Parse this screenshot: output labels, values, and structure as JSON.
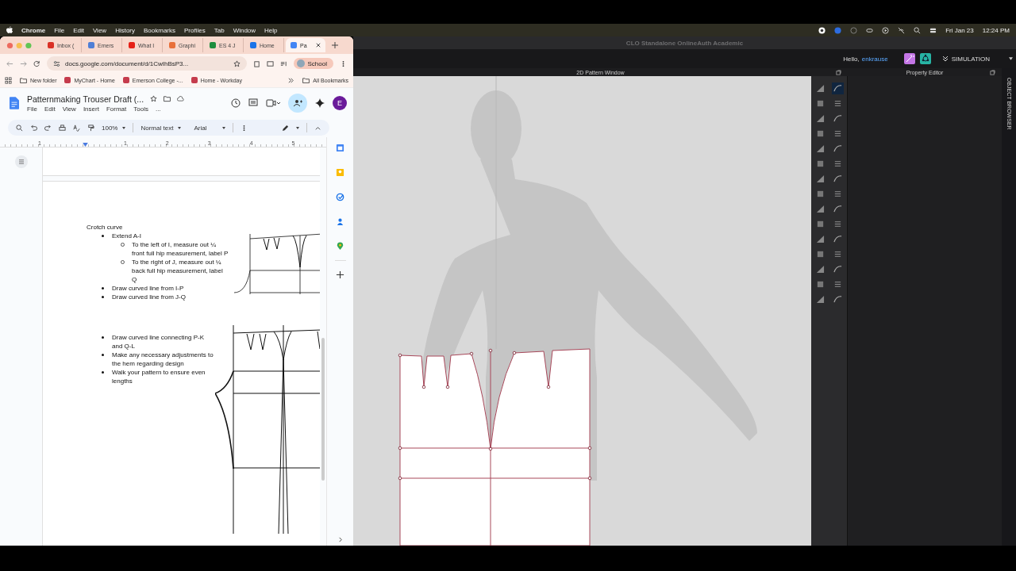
{
  "menu_bar": {
    "app": "Chrome",
    "items": [
      "File",
      "Edit",
      "View",
      "History",
      "Bookmarks",
      "Profiles",
      "Tab",
      "Window",
      "Help"
    ],
    "date": "Fri Jan 23",
    "time": "12:24 PM"
  },
  "browser": {
    "tabs": [
      {
        "label": "Inbox (",
        "color": "#d93025",
        "selected": false
      },
      {
        "label": "Emers",
        "color": "#4f7fd6",
        "selected": false
      },
      {
        "label": "What I",
        "color": "#e62117",
        "selected": false
      },
      {
        "label": "Graphi",
        "color": "#e8703a",
        "selected": false
      },
      {
        "label": "ES 4 J",
        "color": "#1e8e3e",
        "selected": false
      },
      {
        "label": "Home",
        "color": "#1a73e8",
        "selected": false
      },
      {
        "label": "Pa",
        "color": "#4285f4",
        "selected": true
      }
    ],
    "address": "docs.google.com/document/d/1CwIhBsP3...",
    "profile": "School",
    "bookmarks": [
      {
        "label": "New folder",
        "kind": "folder"
      },
      {
        "label": "MyChart - Home",
        "kind": "site"
      },
      {
        "label": "Emerson College -...",
        "kind": "site"
      },
      {
        "label": "Home - Workday",
        "kind": "site"
      }
    ],
    "all_bookmarks": "All Bookmarks"
  },
  "doc": {
    "title": "Patternmaking Trouser Draft (...",
    "menus": [
      "File",
      "Edit",
      "View",
      "Insert",
      "Format",
      "Tools",
      "..."
    ],
    "avatar": "E",
    "zoom": "100%",
    "style": "Normal text",
    "font": "Arial",
    "ruler": [
      "1",
      "1",
      "2",
      "3",
      "4",
      "5"
    ],
    "heading": "Crotch curve",
    "steps": [
      {
        "text": "Extend A-I",
        "children": [
          {
            "text": "To the left of I, measure out ¼ front full hip measurement, label P"
          },
          {
            "text": "To the right of J, measure out ¼ back full hip measurement, label Q"
          }
        ]
      },
      {
        "text": "Draw curved line from I-P"
      },
      {
        "text": "Draw curved line from J-Q"
      }
    ],
    "steps_2": [
      "Draw curved line connecting P-K and Q-L",
      "Make any necessary adjustments to the hem regarding design",
      "Walk your pattern to ensure even lengths"
    ]
  },
  "clo": {
    "title": "CLO Standalone OnlineAuth Academic",
    "greeting": "Hello,",
    "user": "enkrause",
    "mode": "SIMULATION",
    "pattern_window": "2D Pattern Window",
    "property_editor": "Property Editor",
    "object_browser": "OBJECT BROWSER"
  }
}
